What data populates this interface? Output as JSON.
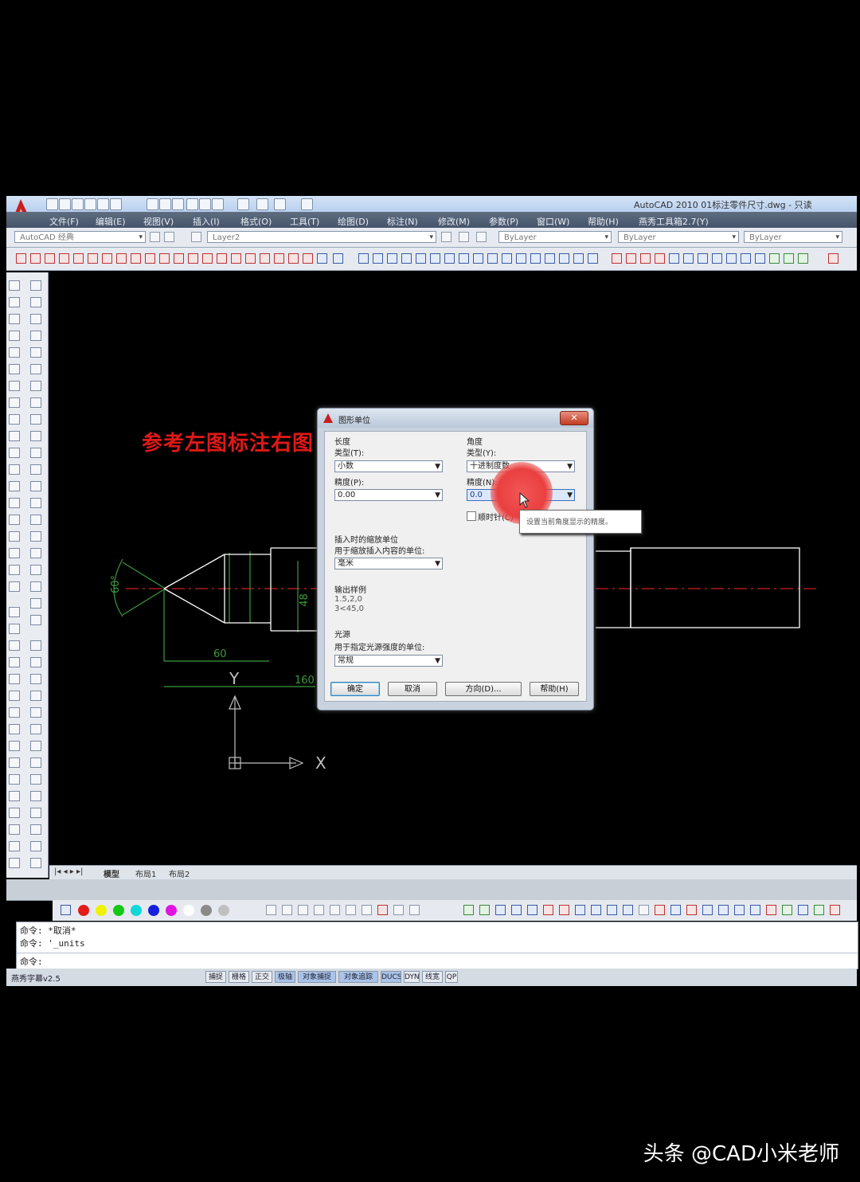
{
  "window": {
    "title": "AutoCAD 2010    01标注零件尺寸.dwg - 只读"
  },
  "menu": [
    "文件(F)",
    "编辑(E)",
    "视图(V)",
    "插入(I)",
    "格式(O)",
    "工具(T)",
    "绘图(D)",
    "标注(N)",
    "修改(M)",
    "参数(P)",
    "窗口(W)",
    "帮助(H)",
    "燕秀工具箱2.7(Y)"
  ],
  "toolbar": {
    "workspace": "AutoCAD 经典",
    "layer": "Layer2",
    "color": "ByLayer",
    "linetype": "ByLayer",
    "lineweight": "ByLayer"
  },
  "canvas": {
    "note": "参考左图标注右图",
    "dims": {
      "angle": "60°",
      "d1": "60",
      "d2": "160",
      "d3": "48"
    },
    "ucs": {
      "x": "X",
      "y": "Y"
    }
  },
  "layout_tabs": [
    "模型",
    "布局1",
    "布局2"
  ],
  "dialog": {
    "title": "图形单位",
    "close": "✕",
    "length": {
      "group": "长度",
      "type_label": "类型(T):",
      "type_value": "小数",
      "precision_label": "精度(P):",
      "precision_value": "0.00"
    },
    "angle": {
      "group": "角度",
      "type_label": "类型(Y):",
      "type_value": "十进制度数",
      "precision_label": "精度(N):",
      "precision_value": "0.0",
      "clockwise_label": "顺时针(C)"
    },
    "insert": {
      "group": "插入时的缩放单位",
      "desc": "用于缩放插入内容的单位:",
      "value": "毫米"
    },
    "sample": {
      "group": "输出样例",
      "line1": "1.5,2,0",
      "line2": "3<45,0"
    },
    "lighting": {
      "group": "光源",
      "desc": "用于指定光源强度的单位:",
      "value": "常规"
    },
    "buttons": {
      "ok": "确定",
      "cancel": "取消",
      "direction": "方向(D)...",
      "help": "帮助(H)"
    }
  },
  "tooltip": "设置当前角度显示的精度。",
  "command": {
    "line1": "命令: *取消*",
    "line2": "命令: '_units",
    "prompt": "命令:"
  },
  "status": {
    "left": "燕秀字幕v2.5",
    "buttons": [
      "捕捉",
      "栅格",
      "正交",
      "极轴",
      "对象捕捉",
      "对象追踪",
      "DUCS",
      "DYN",
      "线宽",
      "QP"
    ]
  },
  "watermark": "头条 @CAD小米老师",
  "colors": {
    "accent_red": "#e01818",
    "drawing_green": "#3c9a3c",
    "centerline": "#cc2020"
  }
}
